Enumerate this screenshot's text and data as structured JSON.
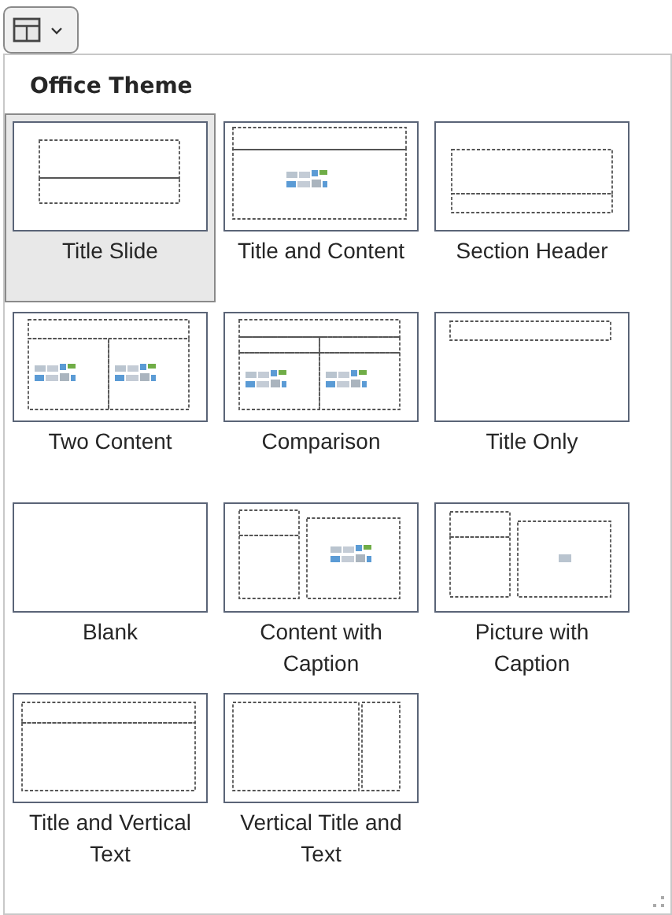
{
  "section": {
    "title": "Office Theme"
  },
  "layouts": [
    {
      "label": "Title Slide",
      "kind": "title",
      "selected": true
    },
    {
      "label": "Title and Content",
      "kind": "content",
      "selected": false
    },
    {
      "label": "Section Header",
      "kind": "section",
      "selected": false
    },
    {
      "label": "Two Content",
      "kind": "two",
      "selected": false
    },
    {
      "label": "Comparison",
      "kind": "comparison",
      "selected": false
    },
    {
      "label": "Title Only",
      "kind": "titleonly",
      "selected": false
    },
    {
      "label": "Blank",
      "kind": "blank",
      "selected": false
    },
    {
      "label": "Content with Caption",
      "kind": "contentcaption",
      "selected": false
    },
    {
      "label": "Picture with Caption",
      "kind": "picturecaption",
      "selected": false
    },
    {
      "label": "Title and Vertical Text",
      "kind": "verticaltext",
      "selected": false
    },
    {
      "label": "Vertical Title and Text",
      "kind": "verticaltitle",
      "selected": false
    }
  ]
}
